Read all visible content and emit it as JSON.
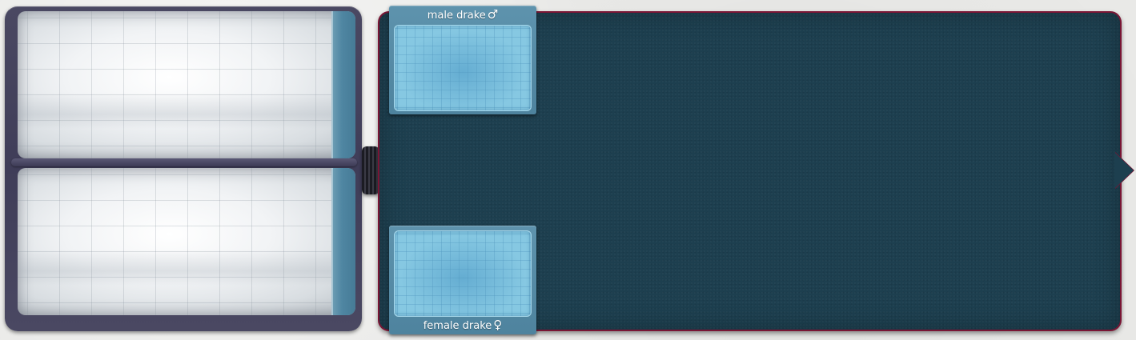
{
  "breeding": {
    "male_slot": {
      "label": "male drake",
      "symbol": "♂"
    },
    "female_slot": {
      "label": "female drake",
      "symbol": "♀"
    }
  },
  "colors": {
    "panel_background": "#1d3f4f",
    "panel_border": "#7a1534",
    "slot_frame": "#5e93ad",
    "slot_pad": "#86c8e2",
    "screen_frame": "#4a4862"
  }
}
